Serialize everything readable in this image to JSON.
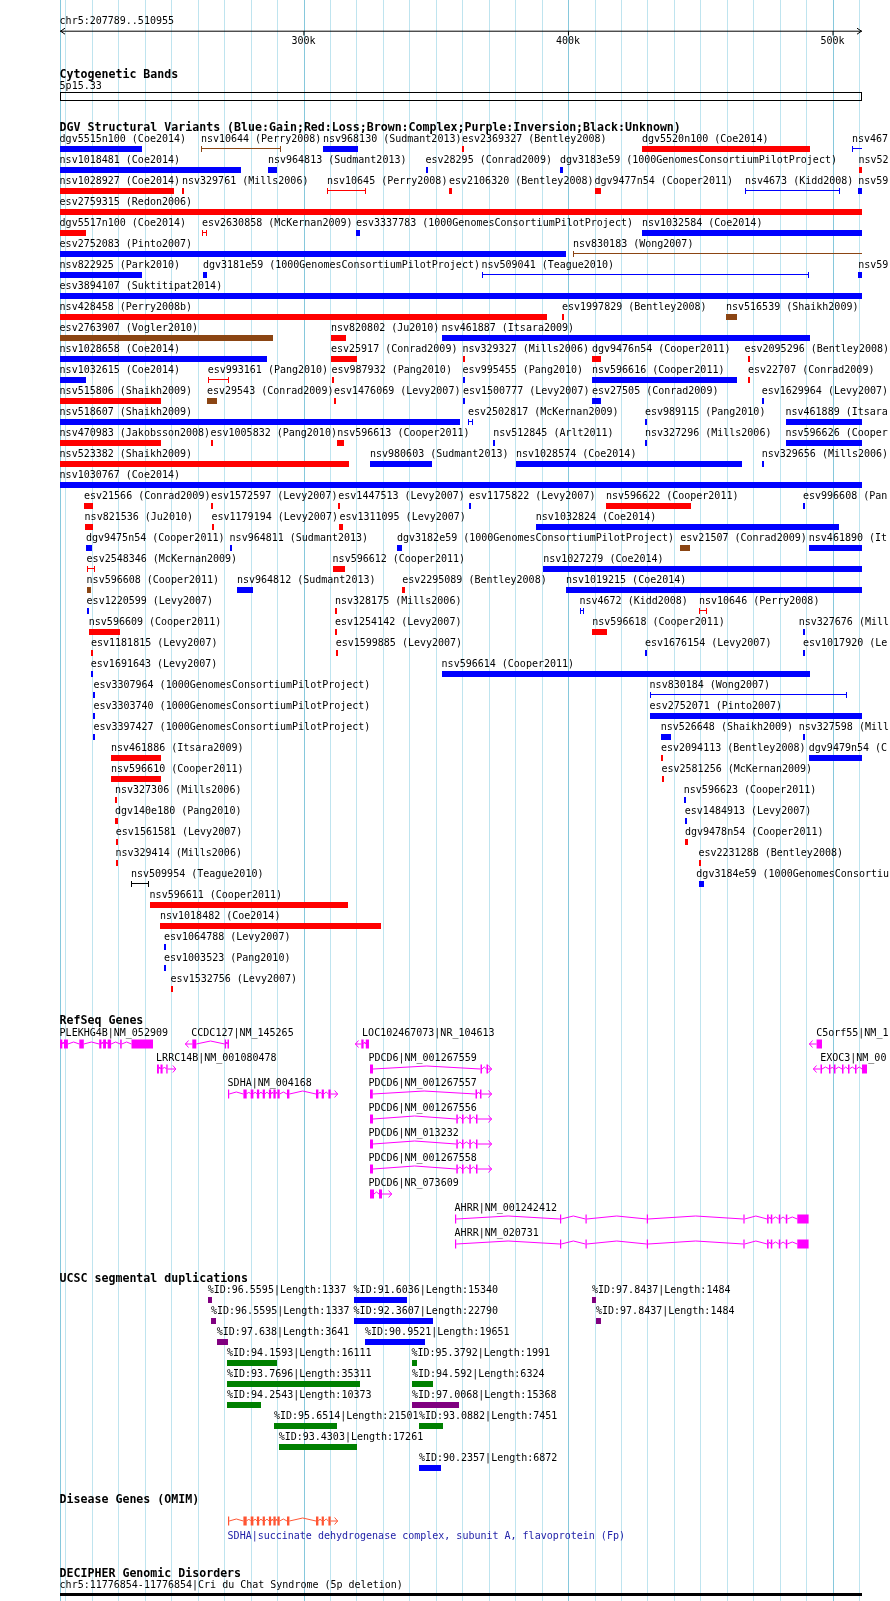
{
  "ruler": {
    "region": "chr5:207789..510955",
    "ticks": [
      "300k",
      "400k",
      "500k"
    ]
  },
  "cytogenetic_bands": {
    "title": "Cytogenetic Bands",
    "band": "5p15.33"
  },
  "dgv_variants": {
    "title": "DGV Structural Variants (Blue:Gain;Red:Loss;Brown:Complex;Purple:Inversion;Black:Unknown)",
    "rows": [
      [
        {
          "label": "dgv5515n100 (Coe2014)",
          "color": "#0000ff",
          "kind": "bar"
        },
        {
          "label": "nsv10644 (Perry2008)",
          "color": "#8b4513",
          "kind": "span"
        },
        {
          "label": "nsv968130 (Sudmant2013)",
          "color": "#0000ff",
          "kind": "bar"
        },
        {
          "label": "esv2369327 (Bentley2008)",
          "color": "#ff0000",
          "kind": "bar"
        },
        {
          "label": "dgv5520n100 (Coe2014)",
          "color": "#ff0000",
          "kind": "bar"
        },
        {
          "label": "nsv467",
          "color": "#0000ff",
          "kind": "span"
        }
      ],
      [
        {
          "label": "nsv1018481 (Coe2014)",
          "color": "#0000ff",
          "kind": "bar"
        },
        {
          "label": "nsv964813 (Sudmant2013)",
          "color": "#0000ff",
          "kind": "bar"
        },
        {
          "label": "esv28295 (Conrad2009)",
          "color": "#0000ff",
          "kind": "bar"
        },
        {
          "label": "dgv3183e59 (1000GenomesConsortiumPilotProject)",
          "color": "#0000ff",
          "kind": "bar"
        },
        {
          "label": "nsv52",
          "color": "#ff0000",
          "kind": "bar"
        }
      ],
      [
        {
          "label": "nsv1028927 (Coe2014)",
          "color": "#ff0000",
          "kind": "bar"
        },
        {
          "label": "nsv329761 (Mills2006)",
          "color": "#ff0000",
          "kind": "bar"
        },
        {
          "label": "nsv10645 (Perry2008)",
          "color": "#ff0000",
          "kind": "span"
        },
        {
          "label": "esv2106320 (Bentley2008)",
          "color": "#ff0000",
          "kind": "bar"
        },
        {
          "label": "dgv9477n54 (Cooper2011)",
          "color": "#ff0000",
          "kind": "bar"
        },
        {
          "label": "nsv4673 (Kidd2008)",
          "color": "#0000ff",
          "kind": "span"
        },
        {
          "label": "nsv59",
          "color": "#0000ff",
          "kind": "bar"
        }
      ],
      [
        {
          "label": "esv2759315 (Redon2006)",
          "color": "#ff0000",
          "kind": "bar"
        }
      ],
      [
        {
          "label": "dgv5517n100 (Coe2014)",
          "color": "#ff0000",
          "kind": "bar"
        },
        {
          "label": "esv2630858 (McKernan2009)",
          "color": "#ff0000",
          "kind": "span"
        },
        {
          "label": "esv3337783 (1000GenomesConsortiumPilotProject)",
          "color": "#0000ff",
          "kind": "bar"
        },
        {
          "label": "nsv1032584 (Coe2014)",
          "color": "#0000ff",
          "kind": "bar"
        }
      ],
      [
        {
          "label": "esv2752083 (Pinto2007)",
          "color": "#0000ff",
          "kind": "bar"
        },
        {
          "label": "nsv830183 (Wong2007)",
          "color": "#8b4513",
          "kind": "span"
        }
      ],
      [
        {
          "label": "nsv822925 (Park2010)",
          "color": "#0000ff",
          "kind": "bar"
        },
        {
          "label": "dgv3181e59 (1000GenomesConsortiumPilotProject)",
          "color": "#0000ff",
          "kind": "bar"
        },
        {
          "label": "nsv509041 (Teague2010)",
          "color": "#0000ff",
          "kind": "span"
        },
        {
          "label": "nsv59",
          "color": "#0000ff",
          "kind": "bar"
        }
      ],
      [
        {
          "label": "esv3894107 (Suktitipat2014)",
          "color": "#0000ff",
          "kind": "bar"
        }
      ],
      [
        {
          "label": "nsv428458 (Perry2008b)",
          "color": "#ff0000",
          "kind": "bar"
        },
        {
          "label": "esv1997829 (Bentley2008)",
          "color": "#ff0000",
          "kind": "bar"
        },
        {
          "label": "nsv516539 (Shaikh2009)",
          "color": "#8b4513",
          "kind": "bar"
        }
      ],
      [
        {
          "label": "esv2763907 (Vogler2010)",
          "color": "#8b4513",
          "kind": "bar"
        },
        {
          "label": "nsv820802 (Ju2010)",
          "color": "#ff0000",
          "kind": "bar"
        },
        {
          "label": "nsv461887 (Itsara2009)",
          "color": "#0000ff",
          "kind": "bar"
        }
      ],
      [
        {
          "label": "nsv1028658 (Coe2014)",
          "color": "#0000ff",
          "kind": "bar"
        },
        {
          "label": "esv25917 (Conrad2009)",
          "color": "#ff0000",
          "kind": "bar"
        },
        {
          "label": "nsv329327 (Mills2006)",
          "color": "#ff0000",
          "kind": "bar"
        },
        {
          "label": "dgv9476n54 (Cooper2011)",
          "color": "#ff0000",
          "kind": "bar"
        },
        {
          "label": "esv2095296 (Bentley2008)",
          "color": "#ff0000",
          "kind": "bar"
        }
      ],
      [
        {
          "label": "nsv1032615 (Coe2014)",
          "color": "#0000ff",
          "kind": "bar"
        },
        {
          "label": "esv993161 (Pang2010)",
          "color": "#ff0000",
          "kind": "span"
        },
        {
          "label": "esv987932 (Pang2010)",
          "color": "#ff0000",
          "kind": "bar"
        },
        {
          "label": "esv995455 (Pang2010)",
          "color": "#0000ff",
          "kind": "bar"
        },
        {
          "label": "nsv596616 (Cooper2011)",
          "color": "#0000ff",
          "kind": "bar"
        },
        {
          "label": "esv22707 (Conrad2009)",
          "color": "#ff0000",
          "kind": "bar"
        }
      ],
      [
        {
          "label": "nsv515806 (Shaikh2009)",
          "color": "#ff0000",
          "kind": "bar"
        },
        {
          "label": "esv29543 (Conrad2009)",
          "color": "#8b4513",
          "kind": "bar"
        },
        {
          "label": "esv1476069 (Levy2007)",
          "color": "#ff0000",
          "kind": "bar"
        },
        {
          "label": "esv1500777 (Levy2007)",
          "color": "#0000ff",
          "kind": "bar"
        },
        {
          "label": "esv27505 (Conrad2009)",
          "color": "#0000ff",
          "kind": "bar"
        },
        {
          "label": "esv1629964 (Levy2007)",
          "color": "#0000ff",
          "kind": "bar"
        }
      ],
      [
        {
          "label": "nsv518607 (Shaikh2009)",
          "color": "#0000ff",
          "kind": "bar"
        },
        {
          "label": "esv2502817 (McKernan2009)",
          "color": "#0000ff",
          "kind": "span"
        },
        {
          "label": "esv989115 (Pang2010)",
          "color": "#0000ff",
          "kind": "bar"
        },
        {
          "label": "nsv461889 (Itsara",
          "color": "#0000ff",
          "kind": "bar"
        }
      ],
      [
        {
          "label": "nsv470983 (Jakobsson2008)",
          "color": "#ff0000",
          "kind": "bar"
        },
        {
          "label": "esv1005832 (Pang2010)",
          "color": "#ff0000",
          "kind": "bar"
        },
        {
          "label": "nsv596613 (Cooper2011)",
          "color": "#ff0000",
          "kind": "bar"
        },
        {
          "label": "nsv512845 (Arlt2011)",
          "color": "#0000ff",
          "kind": "bar"
        },
        {
          "label": "nsv327296 (Mills2006)",
          "color": "#0000ff",
          "kind": "bar"
        },
        {
          "label": "nsv596626 (Cooper",
          "color": "#0000ff",
          "kind": "bar"
        }
      ],
      [
        {
          "label": "nsv523382 (Shaikh2009)",
          "color": "#ff0000",
          "kind": "bar"
        },
        {
          "label": "nsv980603 (Sudmant2013)",
          "color": "#0000ff",
          "kind": "bar"
        },
        {
          "label": "nsv1028574 (Coe2014)",
          "color": "#0000ff",
          "kind": "bar"
        },
        {
          "label": "nsv329656 (Mills2006)",
          "color": "#0000ff",
          "kind": "bar"
        }
      ],
      [
        {
          "label": "nsv1030767 (Coe2014)",
          "color": "#0000ff",
          "kind": "bar"
        }
      ],
      [
        {
          "label": "esv21566 (Conrad2009)",
          "color": "#ff0000",
          "kind": "bar"
        },
        {
          "label": "esv1572597 (Levy2007)",
          "color": "#ff0000",
          "kind": "bar"
        },
        {
          "label": "esv1447513 (Levy2007)",
          "color": "#ff0000",
          "kind": "bar"
        },
        {
          "label": "esv1175822 (Levy2007)",
          "color": "#0000ff",
          "kind": "bar"
        },
        {
          "label": "nsv596622 (Cooper2011)",
          "color": "#ff0000",
          "kind": "bar"
        },
        {
          "label": "esv996608 (Pan",
          "color": "#0000ff",
          "kind": "bar"
        }
      ],
      [
        {
          "label": "nsv821536 (Ju2010)",
          "color": "#ff0000",
          "kind": "bar"
        },
        {
          "label": "esv1179194 (Levy2007)",
          "color": "#ff0000",
          "kind": "bar"
        },
        {
          "label": "esv1311095 (Levy2007)",
          "color": "#ff0000",
          "kind": "bar"
        },
        {
          "label": "nsv1032824 (Coe2014)",
          "color": "#0000ff",
          "kind": "bar"
        }
      ],
      [
        {
          "label": "dgv9475n54 (Cooper2011)",
          "color": "#0000ff",
          "kind": "bar"
        },
        {
          "label": "nsv964811 (Sudmant2013)",
          "color": "#0000ff",
          "kind": "bar"
        },
        {
          "label": "dgv3182e59 (1000GenomesConsortiumPilotProject)",
          "color": "#0000ff",
          "kind": "bar"
        },
        {
          "label": "esv21507 (Conrad2009)",
          "color": "#8b4513",
          "kind": "bar"
        },
        {
          "label": "nsv461890 (It",
          "color": "#0000ff",
          "kind": "bar"
        }
      ],
      [
        {
          "label": "esv2548346 (McKernan2009)",
          "color": "#ff0000",
          "kind": "span"
        },
        {
          "label": "nsv596612 (Cooper2011)",
          "color": "#ff0000",
          "kind": "bar"
        },
        {
          "label": "nsv1027279 (Coe2014)",
          "color": "#0000ff",
          "kind": "bar"
        }
      ],
      [
        {
          "label": "nsv596608 (Cooper2011)",
          "color": "#8b4513",
          "kind": "bar"
        },
        {
          "label": "nsv964812 (Sudmant2013)",
          "color": "#0000ff",
          "kind": "bar"
        },
        {
          "label": "esv2295089 (Bentley2008)",
          "color": "#ff0000",
          "kind": "bar"
        },
        {
          "label": "nsv1019215 (Coe2014)",
          "color": "#0000ff",
          "kind": "bar"
        }
      ],
      [
        {
          "label": "esv1220599 (Levy2007)",
          "color": "#0000ff",
          "kind": "bar"
        },
        {
          "label": "nsv328175 (Mills2006)",
          "color": "#ff0000",
          "kind": "bar"
        },
        {
          "label": "nsv4672 (Kidd2008)",
          "color": "#0000ff",
          "kind": "span"
        },
        {
          "label": "nsv10646 (Perry2008)",
          "color": "#ff0000",
          "kind": "span"
        }
      ],
      [
        {
          "label": "nsv596609 (Cooper2011)",
          "color": "#ff0000",
          "kind": "bar"
        },
        {
          "label": "esv1254142 (Levy2007)",
          "color": "#ff0000",
          "kind": "bar"
        },
        {
          "label": "nsv596618 (Cooper2011)",
          "color": "#ff0000",
          "kind": "bar"
        },
        {
          "label": "nsv327676 (Mill",
          "color": "#0000ff",
          "kind": "bar"
        }
      ],
      [
        {
          "label": "esv1181815 (Levy2007)",
          "color": "#ff0000",
          "kind": "bar"
        },
        {
          "label": "esv1599885 (Levy2007)",
          "color": "#ff0000",
          "kind": "bar"
        },
        {
          "label": "esv1676154 (Levy2007)",
          "color": "#0000ff",
          "kind": "bar"
        },
        {
          "label": "esv1017920 (Le",
          "color": "#0000ff",
          "kind": "bar"
        }
      ],
      [
        {
          "label": "esv1691643 (Levy2007)",
          "color": "#0000ff",
          "kind": "bar"
        },
        {
          "label": "nsv596614 (Cooper2011)",
          "color": "#0000ff",
          "kind": "bar"
        }
      ],
      [
        {
          "label": "esv3307964 (1000GenomesConsortiumPilotProject)",
          "color": "#0000ff",
          "kind": "bar"
        },
        {
          "label": "nsv830184 (Wong2007)",
          "color": "#0000ff",
          "kind": "span"
        }
      ],
      [
        {
          "label": "esv3303740 (1000GenomesConsortiumPilotProject)",
          "color": "#0000ff",
          "kind": "bar"
        },
        {
          "label": "esv2752071 (Pinto2007)",
          "color": "#0000ff",
          "kind": "bar"
        }
      ],
      [
        {
          "label": "esv3397427 (1000GenomesConsortiumPilotProject)",
          "color": "#0000ff",
          "kind": "bar"
        },
        {
          "label": "nsv526648 (Shaikh2009)",
          "color": "#0000ff",
          "kind": "bar"
        },
        {
          "label": "nsv327598 (Mill",
          "color": "#0000ff",
          "kind": "bar"
        }
      ],
      [
        {
          "label": "nsv461886 (Itsara2009)",
          "color": "#ff0000",
          "kind": "bar"
        },
        {
          "label": "esv2094113 (Bentley2008)",
          "color": "#ff0000",
          "kind": "bar"
        },
        {
          "label": "dgv9479n54 (C",
          "color": "#0000ff",
          "kind": "bar"
        }
      ],
      [
        {
          "label": "nsv596610 (Cooper2011)",
          "color": "#ff0000",
          "kind": "bar"
        },
        {
          "label": "esv2581256 (McKernan2009)",
          "color": "#ff0000",
          "kind": "bar"
        }
      ],
      [
        {
          "label": "nsv327306 (Mills2006)",
          "color": "#ff0000",
          "kind": "bar"
        },
        {
          "label": "nsv596623 (Cooper2011)",
          "color": "#0000ff",
          "kind": "bar"
        }
      ],
      [
        {
          "label": "dgv140e180 (Pang2010)",
          "color": "#ff0000",
          "kind": "bar"
        },
        {
          "label": "esv1484913 (Levy2007)",
          "color": "#0000ff",
          "kind": "bar"
        }
      ],
      [
        {
          "label": "esv1561581 (Levy2007)",
          "color": "#ff0000",
          "kind": "bar"
        },
        {
          "label": "dgv9478n54 (Cooper2011)",
          "color": "#ff0000",
          "kind": "bar"
        }
      ],
      [
        {
          "label": "nsv329414 (Mills2006)",
          "color": "#ff0000",
          "kind": "bar"
        },
        {
          "label": "esv2231288 (Bentley2008)",
          "color": "#ff0000",
          "kind": "bar"
        }
      ],
      [
        {
          "label": "nsv509954 (Teague2010)",
          "color": "#000000",
          "kind": "span"
        },
        {
          "label": "dgv3184e59 (1000GenomesConsortiu",
          "color": "#0000ff",
          "kind": "bar"
        }
      ],
      [
        {
          "label": "nsv596611 (Cooper2011)",
          "color": "#ff0000",
          "kind": "bar"
        }
      ],
      [
        {
          "label": "nsv1018482 (Coe2014)",
          "color": "#ff0000",
          "kind": "bar"
        }
      ],
      [
        {
          "label": "esv1064788 (Levy2007)",
          "color": "#0000ff",
          "kind": "bar"
        }
      ],
      [
        {
          "label": "esv1003523 (Pang2010)",
          "color": "#0000ff",
          "kind": "bar"
        }
      ],
      [
        {
          "label": "esv1532756 (Levy2007)",
          "color": "#ff0000",
          "kind": "bar"
        }
      ]
    ]
  },
  "refseq_genes": {
    "title": "RefSeq Genes",
    "genes": [
      {
        "label": "PLEKHG4B|NM_052909"
      },
      {
        "label": "CCDC127|NM_145265"
      },
      {
        "label": "LOC102467073|NR_104613"
      },
      {
        "label": "C5orf55|NM_1"
      },
      {
        "label": "LRRC14B|NM_001080478"
      },
      {
        "label": "PDCD6|NM_001267559"
      },
      {
        "label": "EXOC3|NM_00"
      },
      {
        "label": "SDHA|NM_004168"
      },
      {
        "label": "PDCD6|NM_001267557"
      },
      {
        "label": "PDCD6|NM_001267556"
      },
      {
        "label": "PDCD6|NM_013232"
      },
      {
        "label": "PDCD6|NM_001267558"
      },
      {
        "label": "PDCD6|NR_073609"
      },
      {
        "label": "AHRR|NM_001242412"
      },
      {
        "label": "AHRR|NM_020731"
      }
    ]
  },
  "segmental_duplications": {
    "title": "UCSC segmental duplications",
    "duplications": [
      {
        "label": "%ID:96.5595|Length:1337",
        "color": "#800080"
      },
      {
        "label": "%ID:91.6036|Length:15340",
        "color": "#0000ff"
      },
      {
        "label": "%ID:97.8437|Length:1484",
        "color": "#800080"
      },
      {
        "label": "%ID:96.5595|Length:1337",
        "color": "#800080"
      },
      {
        "label": "%ID:92.3607|Length:22790",
        "color": "#0000ff"
      },
      {
        "label": "%ID:97.8437|Length:1484",
        "color": "#800080"
      },
      {
        "label": "%ID:97.638|Length:3641",
        "color": "#800080"
      },
      {
        "label": "%ID:90.9521|Length:19651",
        "color": "#0000ff"
      },
      {
        "label": "%ID:94.1593|Length:16111",
        "color": "#008000"
      },
      {
        "label": "%ID:95.3792|Length:1991",
        "color": "#008000"
      },
      {
        "label": "%ID:93.7696|Length:35311",
        "color": "#008000"
      },
      {
        "label": "%ID:94.592|Length:6324",
        "color": "#008000"
      },
      {
        "label": "%ID:94.2543|Length:10373",
        "color": "#008000"
      },
      {
        "label": "%ID:97.0068|Length:15368",
        "color": "#800080"
      },
      {
        "label": "%ID:95.6514|Length:21501",
        "color": "#008000"
      },
      {
        "label": "%ID:93.0882|Length:7451",
        "color": "#008000"
      },
      {
        "label": "%ID:93.4303|Length:17261",
        "color": "#008000"
      },
      {
        "label": "%ID:90.2357|Length:6872",
        "color": "#0000ff"
      }
    ]
  },
  "disease_genes": {
    "title": "Disease Genes (OMIM)",
    "genes": [
      {
        "label": "SDHA|succinate dehydrogenase complex, subunit A, flavoprotein (Fp)"
      }
    ]
  },
  "genomic_disorders": {
    "title": "DECIPHER Genomic Disorders",
    "disorders": [
      {
        "label": "chr5:11776854-11776854|Cri du Chat Syndrome (5p deletion)"
      }
    ]
  }
}
